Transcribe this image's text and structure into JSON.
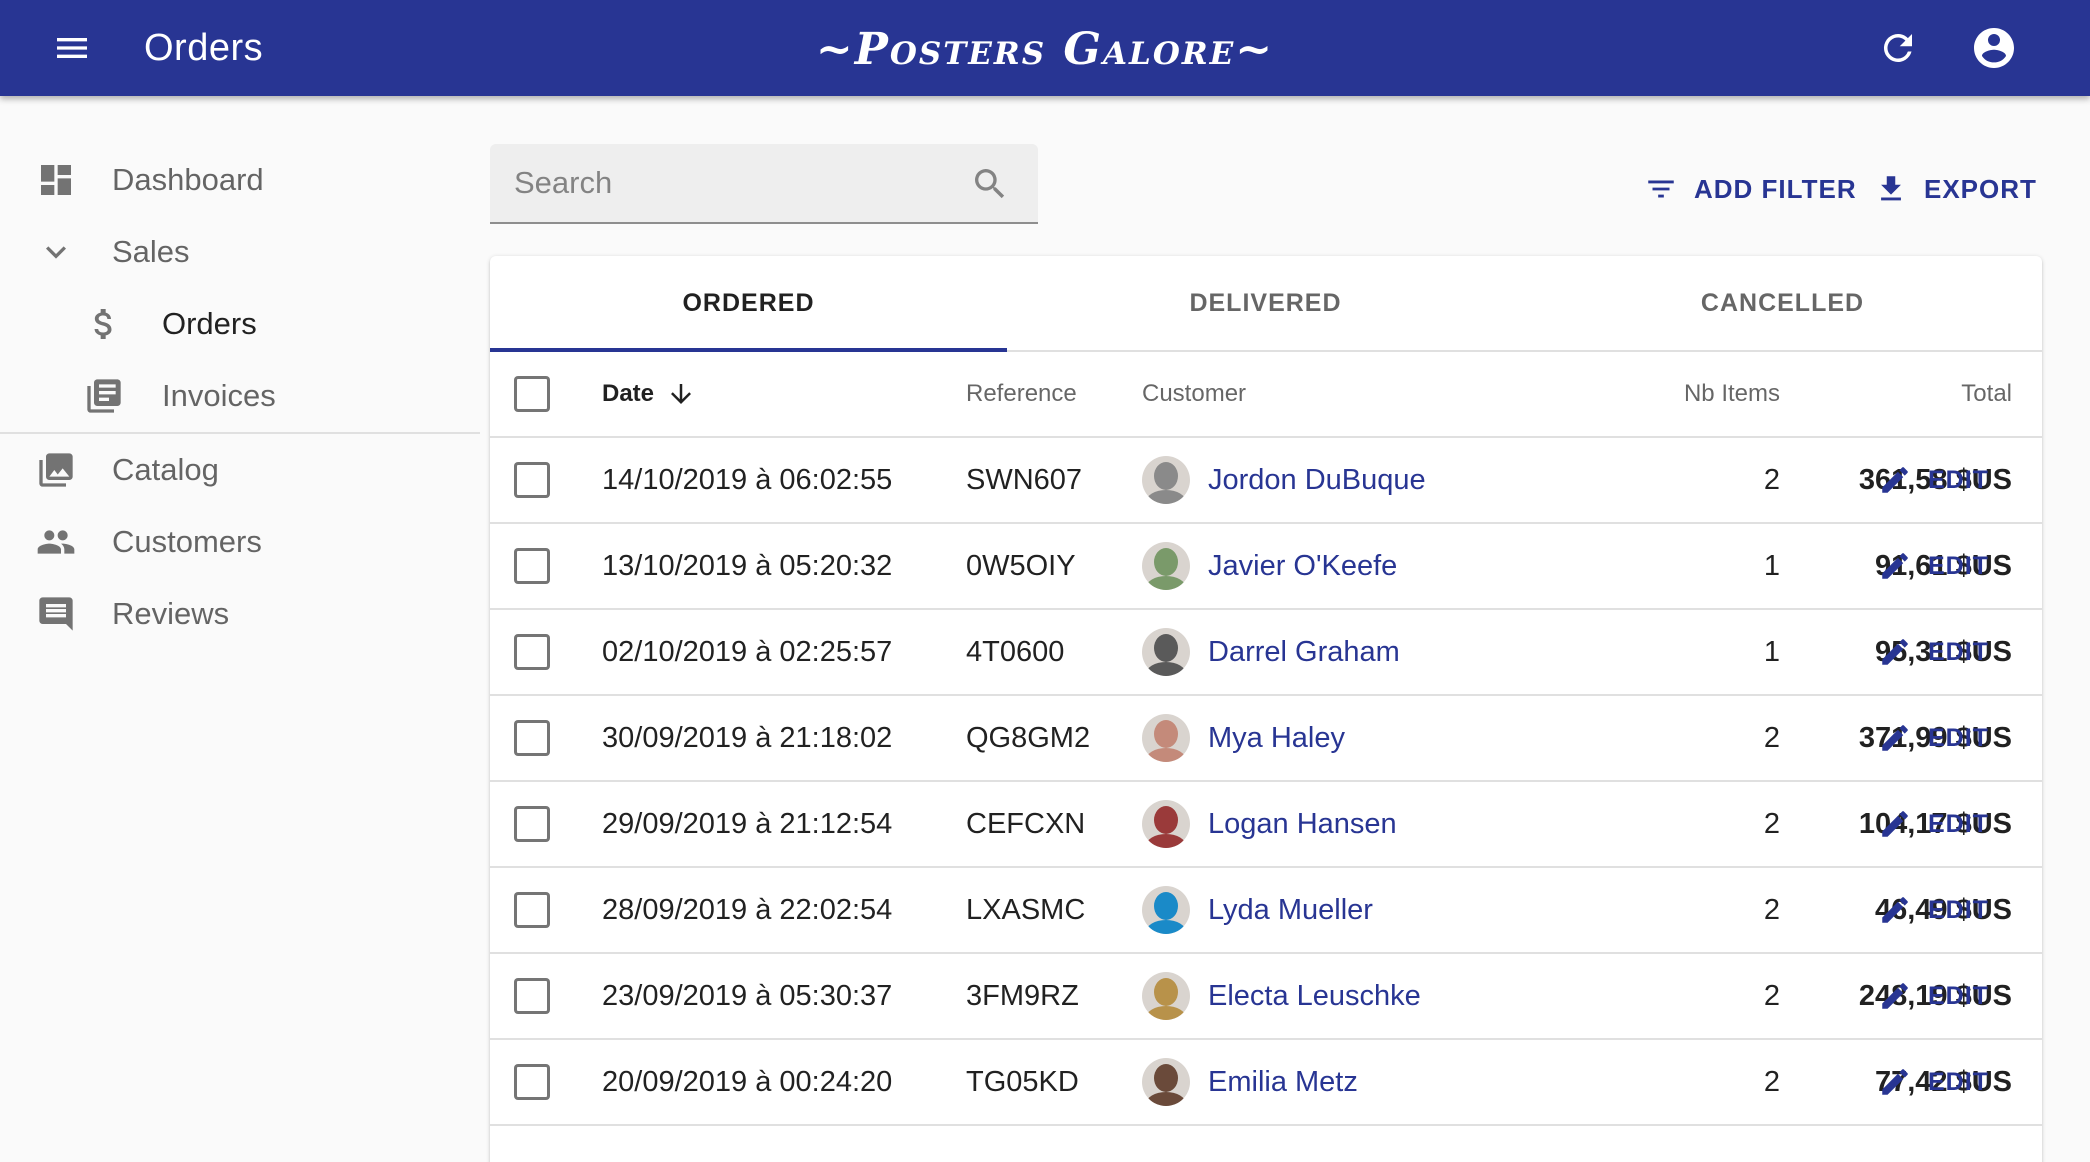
{
  "appbar": {
    "title": "Orders",
    "brand": "~Posters Galore~",
    "menu_icon": "menu-icon",
    "refresh_icon": "refresh-icon",
    "account_icon": "account-circle-icon",
    "color": "#283593"
  },
  "sidebar": {
    "items": [
      {
        "label": "Dashboard",
        "icon": "dashboard-icon"
      },
      {
        "label": "Sales",
        "icon": "chevron-down-icon"
      },
      {
        "label": "Orders",
        "icon": "dollar-icon"
      },
      {
        "label": "Invoices",
        "icon": "invoices-icon"
      },
      {
        "label": "Catalog",
        "icon": "catalog-icon"
      },
      {
        "label": "Customers",
        "icon": "customers-icon"
      },
      {
        "label": "Reviews",
        "icon": "reviews-icon"
      }
    ]
  },
  "toolbar": {
    "search_placeholder": "Search",
    "add_filter_label": "ADD FILTER",
    "export_label": "EXPORT"
  },
  "tabs": [
    {
      "label": "ORDERED",
      "active": true
    },
    {
      "label": "DELIVERED",
      "active": false
    },
    {
      "label": "CANCELLED",
      "active": false
    }
  ],
  "table": {
    "columns": {
      "date": "Date",
      "reference": "Reference",
      "customer": "Customer",
      "nb_items": "Nb Items",
      "total": "Total"
    },
    "edit_label": "EDIT",
    "rows": [
      {
        "date": "14/10/2019 à 06:02:55",
        "reference": "SWN607",
        "customer": "Jordon DuBuque",
        "nb_items": "2",
        "total": "361,58 $US",
        "avatar_color": "#8a8a8a"
      },
      {
        "date": "13/10/2019 à 05:20:32",
        "reference": "0W5OIY",
        "customer": "Javier O'Keefe",
        "nb_items": "1",
        "total": "91,61 $US",
        "avatar_color": "#7a9a6a"
      },
      {
        "date": "02/10/2019 à 02:25:57",
        "reference": "4T0600",
        "customer": "Darrel Graham",
        "nb_items": "1",
        "total": "95,31 $US",
        "avatar_color": "#5a5a5a"
      },
      {
        "date": "30/09/2019 à 21:18:02",
        "reference": "QG8GM2",
        "customer": "Mya Haley",
        "nb_items": "2",
        "total": "371,99 $US",
        "avatar_color": "#c48a7a"
      },
      {
        "date": "29/09/2019 à 21:12:54",
        "reference": "CEFCXN",
        "customer": "Logan Hansen",
        "nb_items": "2",
        "total": "104,17 $US",
        "avatar_color": "#9a3a3a"
      },
      {
        "date": "28/09/2019 à 22:02:54",
        "reference": "LXASMC",
        "customer": "Lyda Mueller",
        "nb_items": "2",
        "total": "46,49 $US",
        "avatar_color": "#1a8ac8"
      },
      {
        "date": "23/09/2019 à 05:30:37",
        "reference": "3FM9RZ",
        "customer": "Electa Leuschke",
        "nb_items": "2",
        "total": "248,19 $US",
        "avatar_color": "#b8924a"
      },
      {
        "date": "20/09/2019 à 00:24:20",
        "reference": "TG05KD",
        "customer": "Emilia Metz",
        "nb_items": "2",
        "total": "77,42 $US",
        "avatar_color": "#6a4a3a"
      }
    ]
  }
}
